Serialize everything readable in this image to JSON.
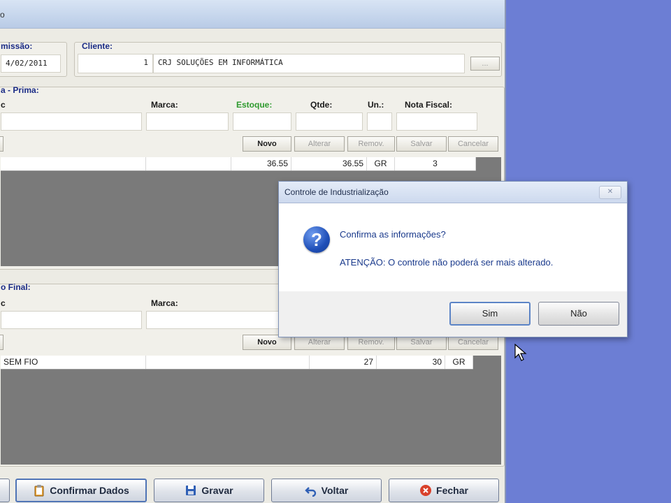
{
  "window": {
    "title": "o"
  },
  "header": {
    "emissao_label": "missão:",
    "emissao_value": "4/02/2011",
    "cliente_label": "Cliente:",
    "cliente_code": "1",
    "cliente_name": "CRJ SOLUÇÕES EM INFORMÁTICA",
    "cliente_lookup_label": "..."
  },
  "materia": {
    "section_label": "a - Prima:",
    "col_labels": {
      "desc": "c",
      "marca": "Marca:",
      "estoque": "Estoque:",
      "qtde": "Qtde:",
      "un": "Un.:",
      "nota": "Nota Fiscal:"
    },
    "buttons": {
      "novo": "Novo",
      "alterar": "Alterar",
      "remov": "Remov.",
      "salvar": "Salvar",
      "cancelar": "Cancelar"
    },
    "rows": [
      {
        "estoque": "36.55",
        "qtde": "36.55",
        "un": "GR",
        "nota": "3"
      }
    ]
  },
  "produto": {
    "section_label": "o Final:",
    "col_labels": {
      "desc": "c",
      "marca": "Marca:"
    },
    "buttons": {
      "novo": "Novo",
      "alterar": "Alterar",
      "remov": "Remov.",
      "salvar": "Salvar",
      "cancelar": "Cancelar"
    },
    "rows": [
      {
        "desc": "SEM FIO",
        "v1": "27",
        "v2": "30",
        "un": "GR"
      }
    ]
  },
  "footer": {
    "confirmar": "Confirmar Dados",
    "gravar": "Gravar",
    "voltar": "Voltar",
    "fechar": "Fechar"
  },
  "dialog": {
    "title": "Controle de Industrialização",
    "close_glyph": "✕",
    "icon_glyph": "?",
    "question": "Confirma as informações?",
    "warning": "ATENÇÃO: O controle não poderá ser mais alterado.",
    "yes_label": "Sim",
    "no_label": "Não"
  },
  "colors": {
    "desktop": "#6c7ed4",
    "label_blue": "#1a2b86",
    "estoque_green": "#2e9a2e"
  }
}
